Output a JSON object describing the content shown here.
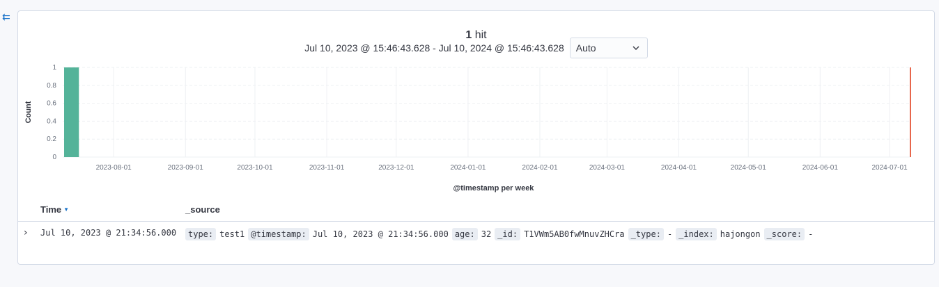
{
  "sidebar": {
    "collapse_icon": "collapse-arrow-icon"
  },
  "header": {
    "hit_count": "1",
    "hit_label": "hit",
    "time_range": "Jul 10, 2023 @ 15:46:43.628 - Jul 10, 2024 @ 15:46:43.628",
    "interval": {
      "selected": "Auto",
      "options": [
        "Auto"
      ]
    }
  },
  "chart_data": {
    "type": "bar",
    "xlabel": "@timestamp per week",
    "ylabel": "Count",
    "ylim": [
      0,
      1
    ],
    "y_ticks": [
      "0",
      "0.2",
      "0.4",
      "0.6",
      "0.8",
      "1"
    ],
    "x_range": [
      "2023-07-10",
      "2024-07-10"
    ],
    "x_ticks": [
      "2023-08-01",
      "2023-09-01",
      "2023-10-01",
      "2023-11-01",
      "2023-12-01",
      "2024-01-01",
      "2024-02-01",
      "2024-03-01",
      "2024-04-01",
      "2024-05-01",
      "2024-06-01",
      "2024-07-01"
    ],
    "bars": [
      {
        "x": "2023-07-10",
        "value": 1
      }
    ],
    "bar_color": "#54b399",
    "current_time_marker": {
      "x": "2024-07-10",
      "color": "#e7664c"
    },
    "grid": true
  },
  "table": {
    "columns": [
      "Time",
      "_source"
    ],
    "sort": "descending",
    "rows": [
      {
        "time": "Jul 10, 2023 @ 21:34:56.000",
        "source": [
          {
            "key": "type:",
            "value": "test1"
          },
          {
            "key": "@timestamp:",
            "value": "Jul 10, 2023 @ 21:34:56.000"
          },
          {
            "key": "age:",
            "value": "32"
          },
          {
            "key": "_id:",
            "value": "T1VWm5AB0fwMnuvZHCra"
          },
          {
            "key": "_type:",
            "value": "-"
          },
          {
            "key": "_index:",
            "value": "hajongon"
          },
          {
            "key": "_score:",
            "value": "-"
          }
        ]
      }
    ]
  }
}
